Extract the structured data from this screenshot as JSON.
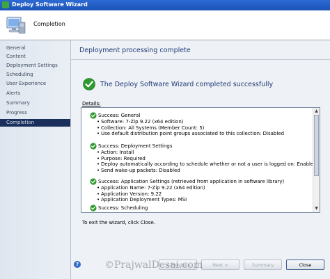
{
  "window": {
    "title": "Deploy Software Wizard"
  },
  "banner": {
    "title": "Completion"
  },
  "sidebar": {
    "items": [
      {
        "label": "General"
      },
      {
        "label": "Content"
      },
      {
        "label": "Deployment Settings"
      },
      {
        "label": "Scheduling"
      },
      {
        "label": "User Experience"
      },
      {
        "label": "Alerts"
      },
      {
        "label": "Summary"
      },
      {
        "label": "Progress"
      },
      {
        "label": "Completion",
        "active": true
      }
    ]
  },
  "main": {
    "heading": "Deployment processing complete",
    "success_message": "The Deploy Software Wizard completed successfully",
    "details_label": "Details:",
    "details": [
      {
        "title": "Success: General",
        "lines": [
          "Software: 7-Zip 9.22 (x64 edition)",
          "Collection: All Systems (Member Count: 5)",
          "Use default distribution point groups associated to this collection: Disabled"
        ]
      },
      {
        "title": "Success: Deployment Settings",
        "lines": [
          "Action: Install",
          "Purpose: Required",
          "Deploy automatically according to schedule whether or not a user is logged on: Enabled",
          "Send wake-up packets: Disabled"
        ]
      },
      {
        "title": "Success: Application Settings (retrieved from application in software library)",
        "lines": [
          "Application Name: 7-Zip 9.22 (x64 edition)",
          "Application Version: 9.22",
          "Application Deployment Types: MSI"
        ]
      },
      {
        "title": "Success: Scheduling",
        "lines": []
      }
    ],
    "exit_note": "To exit the wizard, click Close."
  },
  "footer": {
    "help_label": "?",
    "previous_label": "< Previous",
    "next_label": "Next >",
    "summary_label": "Summary",
    "close_label": "Close"
  },
  "watermark": "©PrajwalDesai.com"
}
